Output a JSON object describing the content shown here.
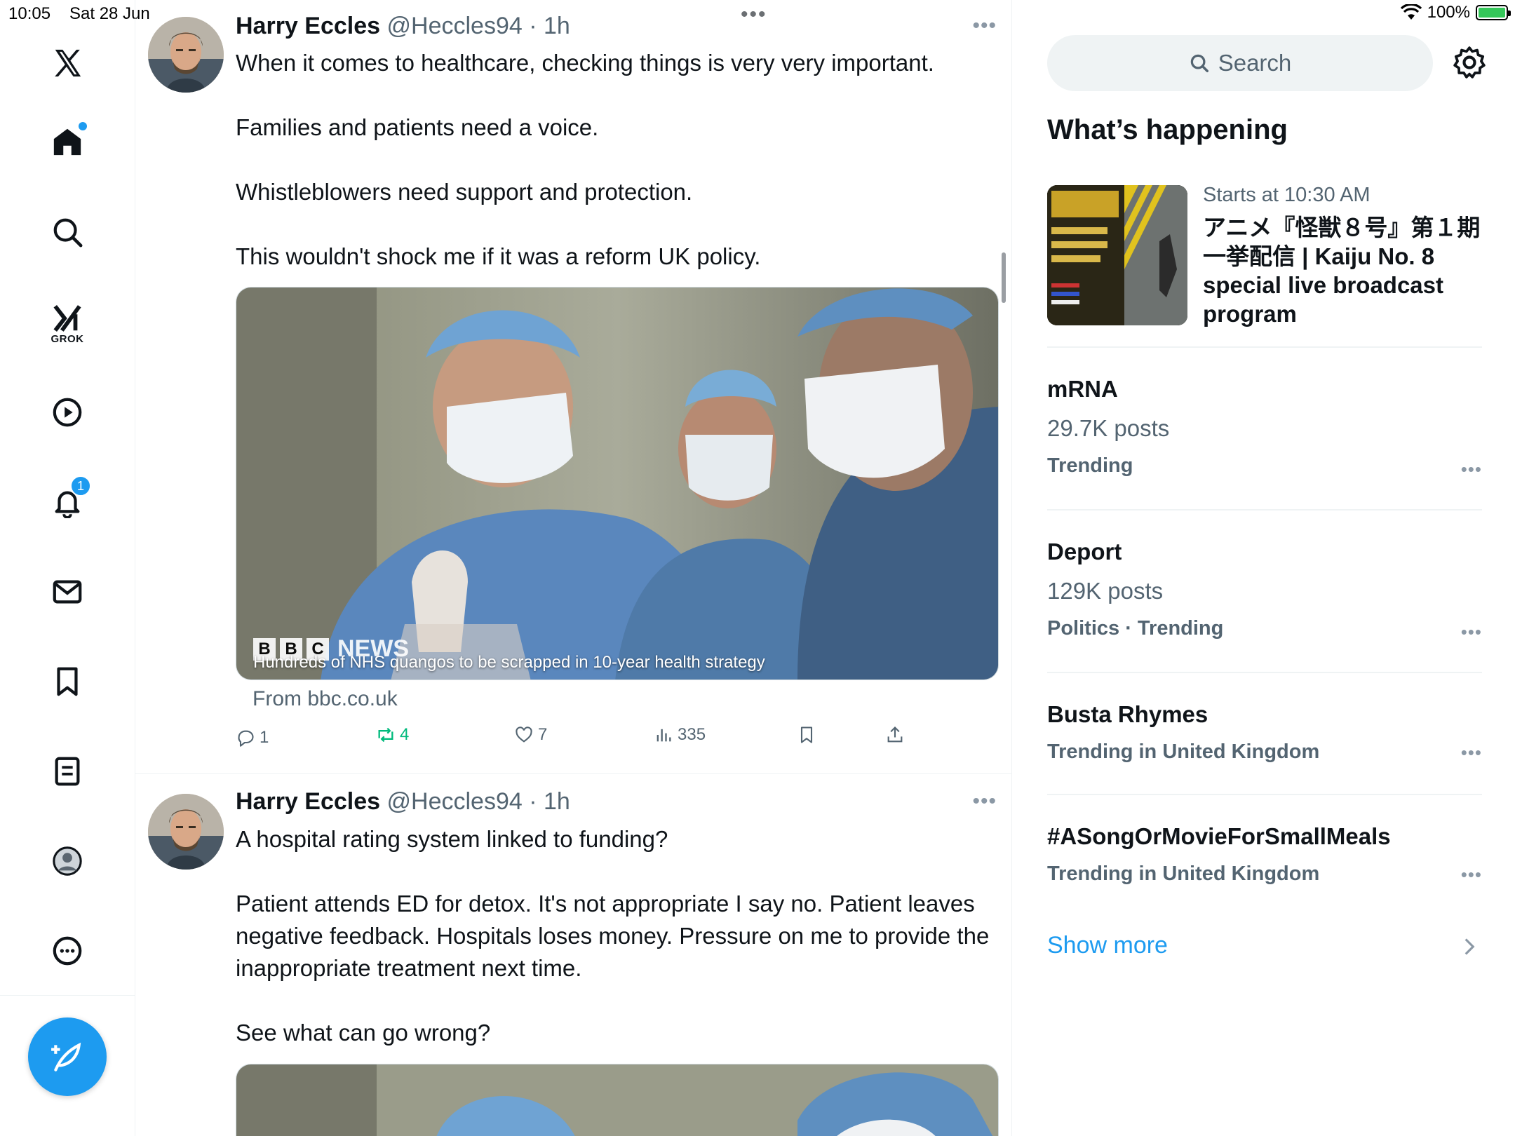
{
  "status_bar": {
    "time": "10:05",
    "date": "Sat 28 Jun",
    "battery": "100%"
  },
  "nav": {
    "grok_label": "GROK",
    "notifications_badge": "1",
    "items": [
      "home-icon",
      "search-icon",
      "grok-icon",
      "video-icon",
      "bell-icon",
      "mail-icon",
      "bookmark-icon",
      "list-icon",
      "profile-icon",
      "more-icon"
    ]
  },
  "tweets": [
    {
      "name": "Harry Eccles",
      "handle": "@Heccles94 · 1h",
      "paragraphs": [
        "When it comes to healthcare, checking things is very very important.",
        "Families and patients need a voice.",
        "Whistleblowers need support and protection.",
        "This wouldn't shock me if it was a reform UK policy."
      ],
      "media_caption": "Hundreds of NHS quangos to be scrapped in 10-year health strategy",
      "media_brand": [
        "B",
        "B",
        "C",
        "NEWS"
      ],
      "link_source": "From bbc.co.uk",
      "replies": "1",
      "reposts": "4",
      "likes": "7",
      "views": "335"
    },
    {
      "name": "Harry Eccles",
      "handle": "@Heccles94 · 1h",
      "paragraphs": [
        "A hospital rating system linked to funding?",
        "Patient attends ED for detox. It's not appropriate I say no. Patient leaves negative feedback. Hospitals loses money. Pressure on me to provide the inappropriate treatment next time.",
        "See what can go wrong?"
      ]
    }
  ],
  "sidebar": {
    "search_placeholder": "Search",
    "section_title": "What’s happening",
    "event": {
      "meta": "Starts at 10:30 AM",
      "title": "アニメ『怪獣８号』第１期一挙配信 | Kaiju No. 8 special live broadcast program"
    },
    "trends": [
      {
        "name": "mRNA",
        "count": "29.7K posts",
        "context": "Trending"
      },
      {
        "name": "Deport",
        "count": "129K posts",
        "context": "Politics · Trending"
      },
      {
        "name": "Busta Rhymes",
        "context": "Trending in United Kingdom"
      },
      {
        "name": "#ASongOrMovieForSmallMeals",
        "context": "Trending in United Kingdom"
      }
    ],
    "show_more": "Show more"
  },
  "colors": {
    "accent": "#1d9bf0",
    "repost": "#00ba7c",
    "secondary_text": "#536471",
    "divider": "#eff3f4"
  }
}
